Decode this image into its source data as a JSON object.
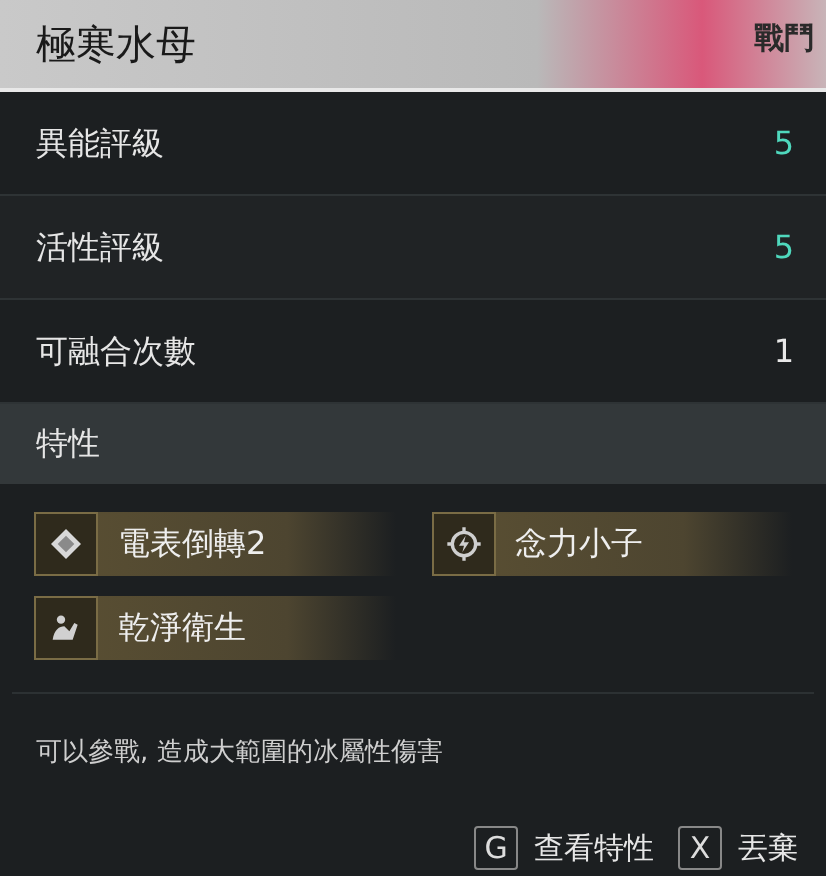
{
  "header": {
    "title": "極寒水母",
    "tag": "戰鬥"
  },
  "stats": [
    {
      "label": "異能評級",
      "value": "5",
      "color": "#4fd8bd"
    },
    {
      "label": "活性評級",
      "value": "5",
      "color": "#4fd8bd"
    },
    {
      "label": "可融合次數",
      "value": "1",
      "color": "#e8e8e8"
    }
  ],
  "traits": {
    "title": "特性",
    "items": [
      {
        "kind": "diamond",
        "label": "電表倒轉2"
      },
      {
        "kind": "target",
        "label": "念力小子"
      },
      {
        "kind": "figure",
        "label": "乾淨衛生"
      }
    ]
  },
  "description": "可以參戰, 造成大範圍的冰屬性傷害",
  "footer": [
    {
      "key": "G",
      "label": "查看特性"
    },
    {
      "key": "X",
      "label": "丟棄"
    }
  ]
}
